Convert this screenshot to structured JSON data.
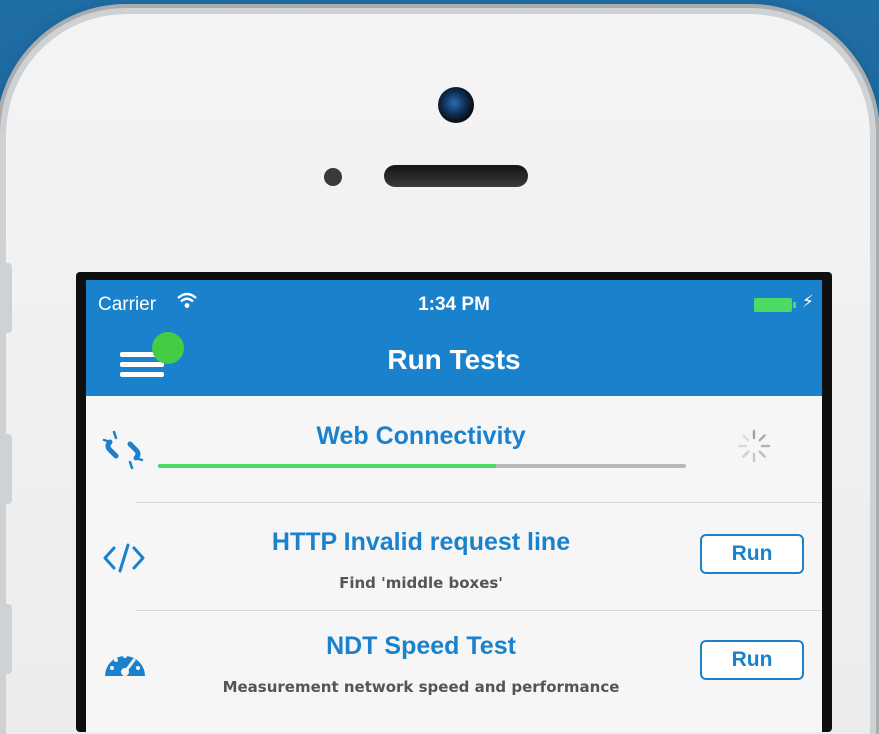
{
  "status_bar": {
    "carrier": "Carrier",
    "time": "1:34 PM"
  },
  "nav": {
    "title": "Run Tests"
  },
  "tests": [
    {
      "title": "Web Connectivity",
      "icon": "broken-link-icon",
      "progress": 0.64
    },
    {
      "title": "HTTP Invalid request line",
      "description": "Find 'middle boxes'",
      "icon": "code-icon",
      "button": "Run"
    },
    {
      "title": "NDT Speed Test",
      "description": "Measurement network speed and performance",
      "icon": "speedometer-icon",
      "button": "Run"
    }
  ],
  "colors": {
    "accent": "#1a82cc",
    "progress": "#4cd964",
    "menu_badge": "#44cc44"
  }
}
